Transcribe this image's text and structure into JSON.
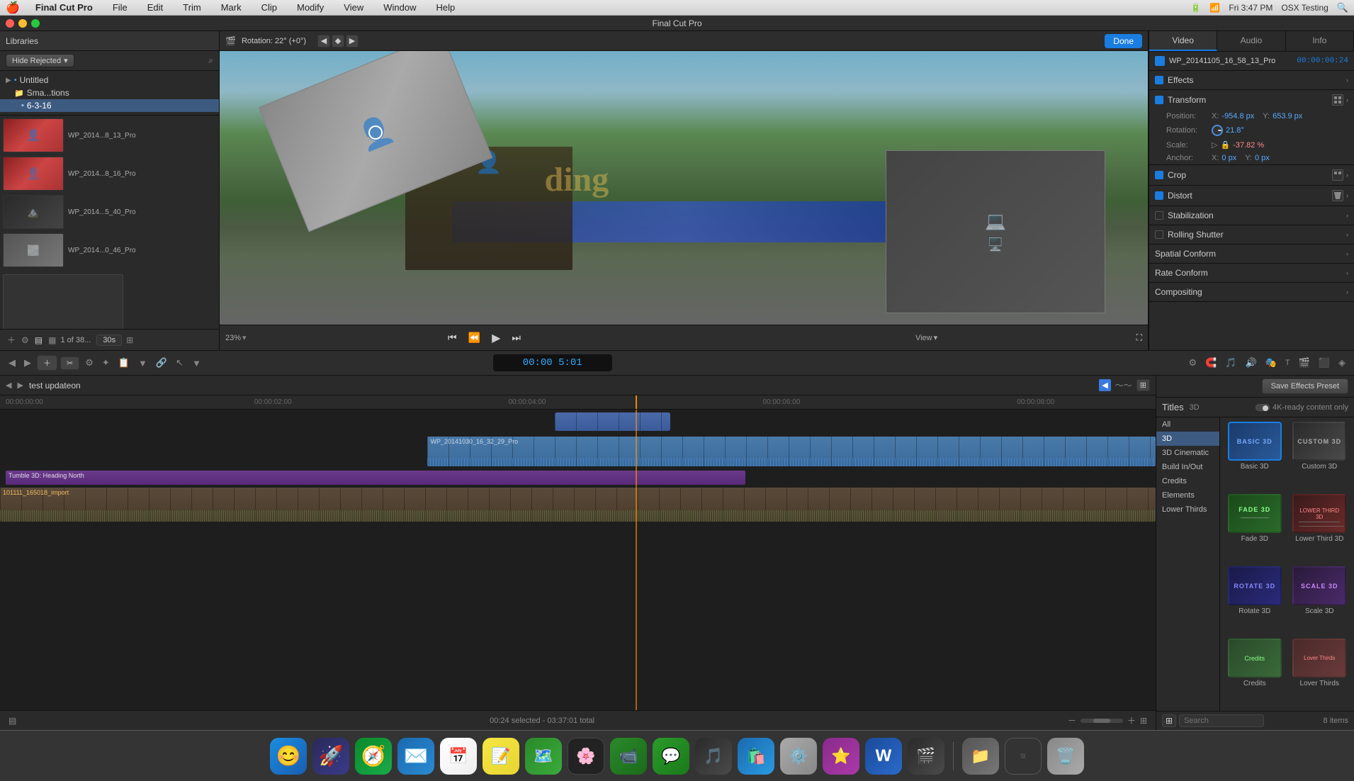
{
  "menubar": {
    "apple": "⌘",
    "items": [
      "Final Cut Pro",
      "File",
      "Edit",
      "Trim",
      "Mark",
      "Clip",
      "Modify",
      "View",
      "Window",
      "Help"
    ],
    "right": {
      "time": "Fri 3:47 PM",
      "testing": "OSX Testing"
    }
  },
  "app_title": "Final Cut Pro",
  "library": {
    "title": "Libraries",
    "hide_rejected": "Hide Rejected",
    "tree": {
      "untitled": "Untitled",
      "sma_tions": "Sma...tions",
      "date": "6-3-16"
    },
    "clips": [
      {
        "label": "WP_2014...8_13_Pro",
        "type": "red"
      },
      {
        "label": "WP_2014...8_16_Pro",
        "type": "red"
      },
      {
        "label": "WP_2014...5_40_Pro",
        "type": "dark"
      },
      {
        "label": "WP_2014...0_46_Pro",
        "type": "gray"
      }
    ],
    "count": "1 of 38..."
  },
  "viewer": {
    "rotation_info": "Rotation: 22° (+0°)",
    "done_label": "Done",
    "zoom": "23%",
    "view_label": "View",
    "timecode": "5:01"
  },
  "inspector": {
    "tabs": [
      "Video",
      "Audio",
      "Info"
    ],
    "active_tab": "Video",
    "clip_name": "WP_20141105_16_58_13_Pro",
    "clip_time": "00:00:00:24",
    "sections": {
      "effects": "Effects",
      "transform": "Transform",
      "crop": "Crop",
      "distort": "Distort",
      "stabilization": "Stabilization",
      "rolling_shutter": "Rolling Shutter",
      "spatial_conform": "Spatial Conform",
      "rate_conform": "Rate Conform",
      "compositing": "Compositing"
    },
    "transform": {
      "position_label": "Position:",
      "position_x_label": "X:",
      "position_x": "-954.8 px",
      "position_y_label": "Y:",
      "position_y": "653.9 px",
      "rotation_label": "Rotation:",
      "rotation_val": "21.8°",
      "scale_label": "Scale:",
      "scale_val": "-37.82 %",
      "anchor_label": "Anchor:",
      "anchor_x_label": "X:",
      "anchor_x": "0 px",
      "anchor_y_label": "Y:",
      "anchor_y": "0 px"
    },
    "save_preset_label": "Save Effects Preset"
  },
  "timeline": {
    "project_name": "test updateon",
    "timecodes": [
      "00:00:00:00",
      "00:00:02:00",
      "00:00:04:00",
      "00:00:06:00",
      "00:00:08:00"
    ],
    "center_timecode": "00:00 5:01",
    "clips": {
      "main_clip": "WP_20141030_16_32_29_Pro",
      "tumble": "Tumble 3D: Heading North",
      "import": "101111_165018_import"
    },
    "status": "00:24 selected - 03:37:01 total"
  },
  "effects_panel": {
    "title": "Titles",
    "badge": "3D",
    "four_k_toggle": "4K-ready content only",
    "categories": [
      {
        "id": "all",
        "label": "All"
      },
      {
        "id": "3d",
        "label": "3D",
        "selected": true
      },
      {
        "id": "3d_cinematic",
        "label": "3D Cinematic"
      },
      {
        "id": "build_in_out",
        "label": "Build In/Out"
      },
      {
        "id": "credits",
        "label": "Credits"
      },
      {
        "id": "elements",
        "label": "Elements"
      },
      {
        "id": "lower_thirds",
        "label": "Lower Thirds"
      }
    ],
    "effects": [
      {
        "id": "basic_3d",
        "label": "Basic 3D",
        "type": "basic",
        "selected": true
      },
      {
        "id": "custom_3d",
        "label": "Custom 3D",
        "type": "custom"
      },
      {
        "id": "fade_3d",
        "label": "Fade 3D",
        "type": "fade"
      },
      {
        "id": "lower_third_3d",
        "label": "Lower Third 3D",
        "type": "lower"
      },
      {
        "id": "rotate_3d",
        "label": "Rotate 3D",
        "type": "rotate"
      },
      {
        "id": "scale_3d",
        "label": "Scale 3D",
        "type": "scale"
      }
    ],
    "item_count": "8 items",
    "search_placeholder": "Search",
    "save_preset": "Save Effects Preset",
    "credits_label": "Credits",
    "lower_thirds_label": "Lover Thirds"
  },
  "dock": {
    "items": [
      {
        "name": "finder",
        "emoji": "🔵",
        "label": "Finder"
      },
      {
        "name": "launchpad",
        "emoji": "🚀",
        "label": "Launchpad"
      },
      {
        "name": "safari",
        "emoji": "🧭",
        "label": "Safari"
      },
      {
        "name": "mail",
        "emoji": "✉️",
        "label": "Mail"
      },
      {
        "name": "calendar",
        "emoji": "📅",
        "label": "Calendar"
      },
      {
        "name": "notes",
        "emoji": "📝",
        "label": "Notes"
      },
      {
        "name": "maps",
        "emoji": "🗺️",
        "label": "Maps"
      },
      {
        "name": "photos",
        "emoji": "🖼️",
        "label": "Photos"
      },
      {
        "name": "facetime",
        "emoji": "📹",
        "label": "FaceTime"
      },
      {
        "name": "imessage",
        "emoji": "💬",
        "label": "Messages"
      },
      {
        "name": "music",
        "emoji": "🎵",
        "label": "Music"
      },
      {
        "name": "appstore",
        "emoji": "🛍️",
        "label": "App Store"
      },
      {
        "name": "systemprefs",
        "emoji": "⚙️",
        "label": "System Preferences"
      },
      {
        "name": "stickies",
        "emoji": "⭐",
        "label": "Stickies"
      },
      {
        "name": "word",
        "emoji": "W",
        "label": "Word"
      },
      {
        "name": "finalcut",
        "emoji": "🎬",
        "label": "Final Cut Pro"
      },
      {
        "name": "finder2",
        "emoji": "📁",
        "label": "Finder"
      },
      {
        "name": "app1",
        "emoji": "▪️",
        "label": "App1"
      },
      {
        "name": "app2",
        "emoji": "▪️",
        "label": "App2"
      },
      {
        "name": "trash",
        "emoji": "🗑️",
        "label": "Trash"
      }
    ]
  }
}
